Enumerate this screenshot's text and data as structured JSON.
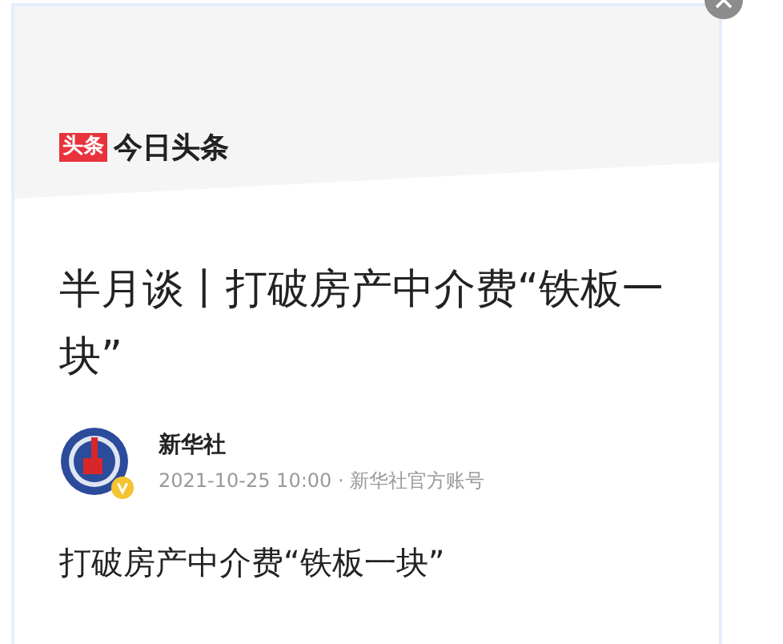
{
  "source": {
    "badge": "头条",
    "name": "今日头条"
  },
  "article": {
    "title": "半月谈丨打破房产中介费“铁板一块”",
    "author": {
      "name": "新华社",
      "verified": true,
      "meta": "2021-10-25 10:00 · 新华社官方账号"
    },
    "subtitle": "打破房产中介费“铁板一块”"
  }
}
